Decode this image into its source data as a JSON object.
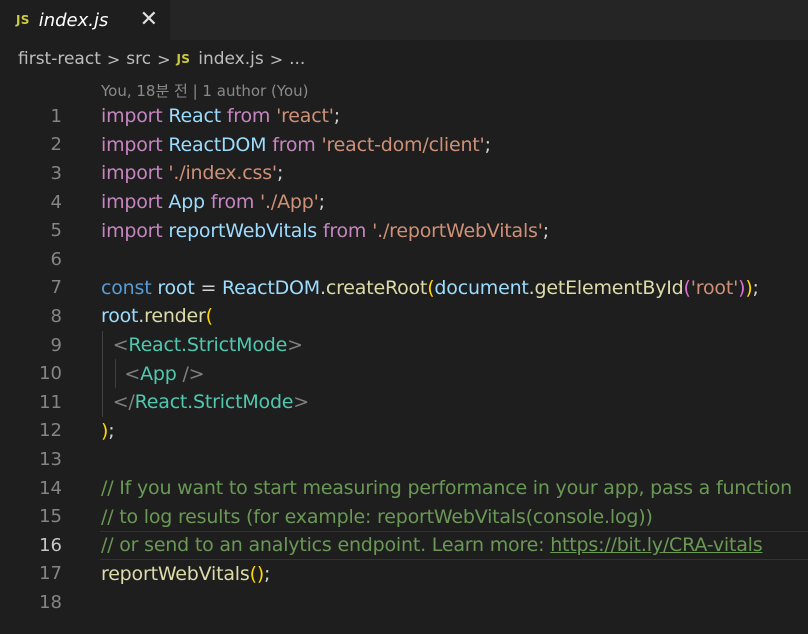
{
  "tab": {
    "badge": "JS",
    "title": "index.js",
    "close": "✕"
  },
  "breadcrumb": {
    "folder": "first-react",
    "sub": "src",
    "badge": "JS",
    "file": "index.js",
    "more": "..."
  },
  "blame": "You, 18분 전 | 1 author (You)",
  "line_numbers": [
    "1",
    "2",
    "3",
    "4",
    "5",
    "6",
    "7",
    "8",
    "9",
    "10",
    "11",
    "12",
    "13",
    "14",
    "15",
    "16",
    "17",
    "18"
  ],
  "code": {
    "l1": {
      "a": "import",
      "b": "React",
      "c": "from",
      "d": "'react'",
      "e": ";"
    },
    "l2": {
      "a": "import",
      "b": "ReactDOM",
      "c": "from",
      "d": "'react-dom/client'",
      "e": ";"
    },
    "l3": {
      "a": "import",
      "b": "'./index.css'",
      "c": ";"
    },
    "l4": {
      "a": "import",
      "b": "App",
      "c": "from",
      "d": "'./App'",
      "e": ";"
    },
    "l5": {
      "a": "import",
      "b": "reportWebVitals",
      "c": "from",
      "d": "'./reportWebVitals'",
      "e": ";"
    },
    "l7": {
      "a": "const",
      "b": "root",
      "c": " = ",
      "d": "ReactDOM",
      "e": ".",
      "f": "createRoot",
      "g": "(",
      "h": "document",
      "i": ".",
      "j": "getElementById",
      "k": "(",
      "l": "'root'",
      "m": ")",
      "n": ")",
      "o": ";"
    },
    "l8": {
      "a": "root",
      "b": ".",
      "c": "render",
      "d": "("
    },
    "l9": {
      "a": "<",
      "b": "React.StrictMode",
      "c": ">"
    },
    "l10": {
      "a": "<",
      "b": "App",
      "c": " />"
    },
    "l11": {
      "a": "</",
      "b": "React.StrictMode",
      "c": ">"
    },
    "l12": {
      "a": ")",
      "b": ";"
    },
    "l14": "// If you want to start measuring performance in your app, pass a function",
    "l15": "// to log results (for example: reportWebVitals(console.log))",
    "l16": {
      "a": "// or send to an analytics endpoint. Learn more: ",
      "b": "https://bit.ly/CRA-vitals"
    },
    "l17": {
      "a": "reportWebVitals",
      "b": "(",
      "c": ")",
      "d": ";"
    }
  }
}
